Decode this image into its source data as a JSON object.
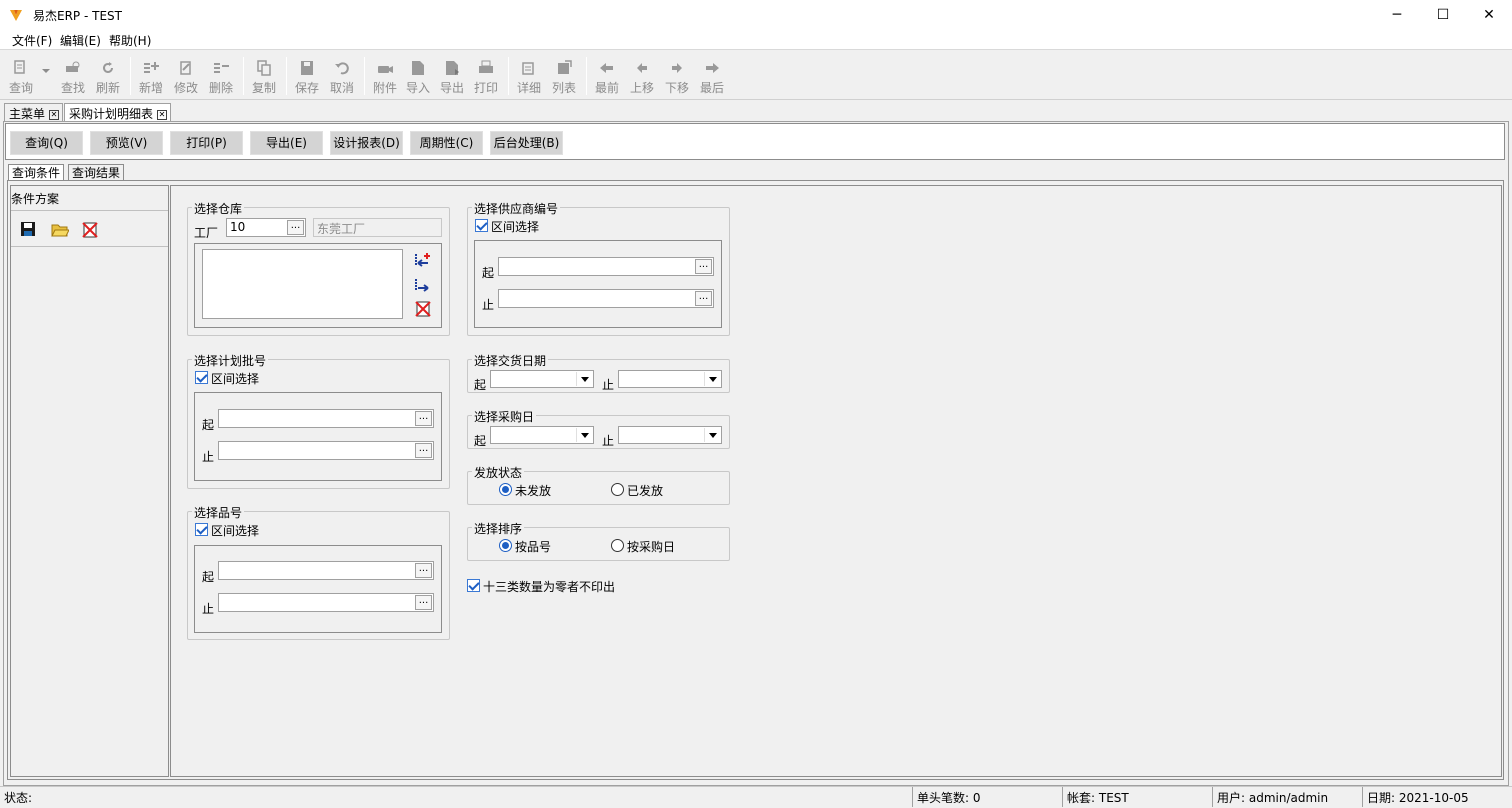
{
  "window": {
    "title": "易杰ERP - TEST",
    "controls": {
      "minimize": "─",
      "maximize": "☐",
      "close": "✕"
    }
  },
  "menu": [
    {
      "label": "文件(F)",
      "key": "F"
    },
    {
      "label": "编辑(E)",
      "key": "E"
    },
    {
      "label": "帮助(H)",
      "key": "H"
    }
  ],
  "toolbar": [
    {
      "label": "查询",
      "icon": "query-icon"
    },
    {
      "label": "查找",
      "icon": "find-icon"
    },
    {
      "label": "刷新",
      "icon": "refresh-icon"
    },
    {
      "label": "新增",
      "icon": "add-icon"
    },
    {
      "label": "修改",
      "icon": "edit-icon"
    },
    {
      "label": "删除",
      "icon": "delete-icon"
    },
    {
      "label": "复制",
      "icon": "copy-icon"
    },
    {
      "label": "保存",
      "icon": "save-icon"
    },
    {
      "label": "取消",
      "icon": "undo-icon"
    },
    {
      "label": "附件",
      "icon": "attachment-icon"
    },
    {
      "label": "导入",
      "icon": "import-icon"
    },
    {
      "label": "导出",
      "icon": "export-icon"
    },
    {
      "label": "打印",
      "icon": "print-icon"
    },
    {
      "label": "详细",
      "icon": "detail-icon"
    },
    {
      "label": "列表",
      "icon": "list-icon"
    },
    {
      "label": "最前",
      "icon": "first-icon"
    },
    {
      "label": "上移",
      "icon": "prev-icon"
    },
    {
      "label": "下移",
      "icon": "next-icon"
    },
    {
      "label": "最后",
      "icon": "last-icon"
    }
  ],
  "doc_tabs": [
    {
      "label": "主菜单"
    },
    {
      "label": "采购计划明细表"
    }
  ],
  "actions": [
    {
      "label": "查询(Q)"
    },
    {
      "label": "预览(V)"
    },
    {
      "label": "打印(P)"
    },
    {
      "label": "导出(E)"
    },
    {
      "label": "设计报表(D)"
    },
    {
      "label": "周期性(C)"
    },
    {
      "label": "后台处理(B)"
    }
  ],
  "inner_tabs": [
    {
      "label": "查询条件"
    },
    {
      "label": "查询结果"
    }
  ],
  "plan": {
    "title": "条件方案"
  },
  "warehouse": {
    "title": "选择仓库",
    "factory_label": "工厂",
    "factory_code": "10",
    "factory_name": "东莞工厂"
  },
  "plan_batch": {
    "title": "选择计划批号",
    "range_label": "区间选择",
    "from_label": "起",
    "to_label": "止",
    "from": "",
    "to": ""
  },
  "item_no": {
    "title": "选择品号",
    "range_label": "区间选择",
    "from_label": "起",
    "to_label": "止",
    "from": "",
    "to": ""
  },
  "supplier": {
    "title": "选择供应商编号",
    "range_label": "区间选择",
    "from_label": "起",
    "to_label": "止",
    "from": "",
    "to": ""
  },
  "delivery_date": {
    "title": "选择交货日期",
    "from_label": "起",
    "to_label": "止"
  },
  "purchase_date": {
    "title": "选择采购日",
    "from_label": "起",
    "to_label": "止"
  },
  "release_status": {
    "title": "发放状态",
    "options": [
      "未发放",
      "已发放"
    ],
    "selected": "未发放"
  },
  "sort": {
    "title": "选择排序",
    "options": [
      "按品号",
      "按采购日"
    ],
    "selected": "按品号"
  },
  "zero_option": {
    "label": "十三类数量为零者不印出",
    "checked": true
  },
  "status": {
    "state": "状态:",
    "header_count": "单头笔数: 0",
    "account": "帐套: TEST",
    "user": "用户: admin/admin",
    "date": "日期: 2021-10-05"
  },
  "colors": {
    "accent": "#1e5fc4",
    "disabled_text": "#8c8c8c",
    "button_face": "#d4d4d4",
    "window_bg": "#f0f0f0"
  }
}
